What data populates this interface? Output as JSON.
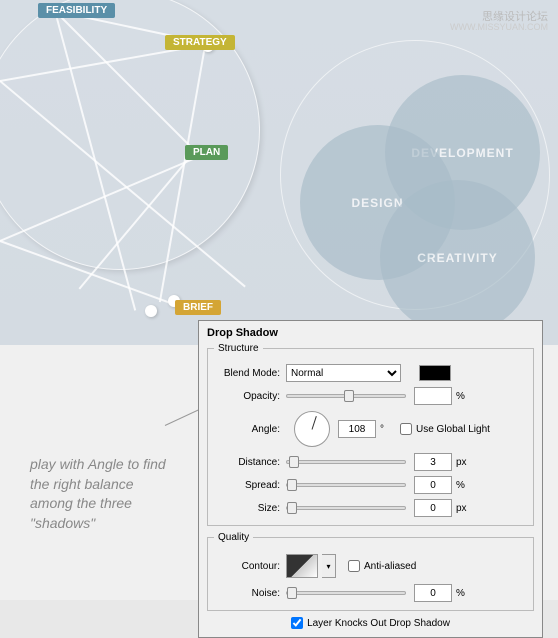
{
  "watermark": "思缘设计论坛",
  "watermark2": "WWW.MISSYUAN.COM",
  "tags": {
    "feasibility": "FEASIBILITY",
    "strategy": "STRATEGY",
    "plan": "PLAN",
    "brief": "BRIEF"
  },
  "venn": {
    "development": "DEVELOPMENT",
    "design": "DESIGN",
    "creativity": "CREATIVITY"
  },
  "annotation": "play with Angle to find the right balance among the three \"shadows\"",
  "dialog": {
    "title": "Drop Shadow",
    "structure": {
      "legend": "Structure",
      "blend_mode_label": "Blend Mode:",
      "blend_mode_value": "Normal",
      "opacity_label": "Opacity:",
      "opacity_value": "49",
      "opacity_unit": "%",
      "angle_label": "Angle:",
      "angle_value": "108",
      "angle_unit": "°",
      "global_light_label": "Use Global Light",
      "distance_label": "Distance:",
      "distance_value": "3",
      "distance_unit": "px",
      "spread_label": "Spread:",
      "spread_value": "0",
      "spread_unit": "%",
      "size_label": "Size:",
      "size_value": "0",
      "size_unit": "px"
    },
    "quality": {
      "legend": "Quality",
      "contour_label": "Contour:",
      "anti_aliased_label": "Anti-aliased",
      "noise_label": "Noise:",
      "noise_value": "0",
      "noise_unit": "%"
    },
    "knockout_label": "Layer Knocks Out Drop Shadow"
  }
}
